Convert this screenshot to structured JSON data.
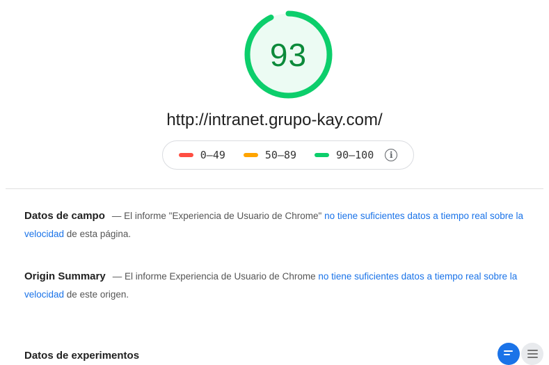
{
  "score": {
    "value": "93",
    "fraction": 0.93,
    "color": "#0cce6b"
  },
  "url": "http://intranet.grupo-kay.com/",
  "legend": [
    {
      "range": "0–49",
      "color": "#ff4e42"
    },
    {
      "range": "50–89",
      "color": "#ffa400"
    },
    {
      "range": "90–100",
      "color": "#0cce6b"
    }
  ],
  "info_icon_glyph": "i",
  "field_data": {
    "title": "Datos de campo",
    "text_before": "— El informe \"Experiencia de Usuario de Chrome\" ",
    "link": "no tiene suficientes datos a tiempo real sobre la velocidad",
    "text_after": " de esta página."
  },
  "origin_summary": {
    "title": "Origin Summary",
    "text_before": "— El informe Experiencia de Usuario de Chrome ",
    "link": "no tiene suficientes datos a tiempo real sobre la velocidad",
    "text_after": " de este origen."
  },
  "lab_data": {
    "title": "Datos de experimentos"
  },
  "view_toggle": {
    "active": "summary-view",
    "icons": [
      "summary-view-icon",
      "list-view-icon"
    ]
  }
}
